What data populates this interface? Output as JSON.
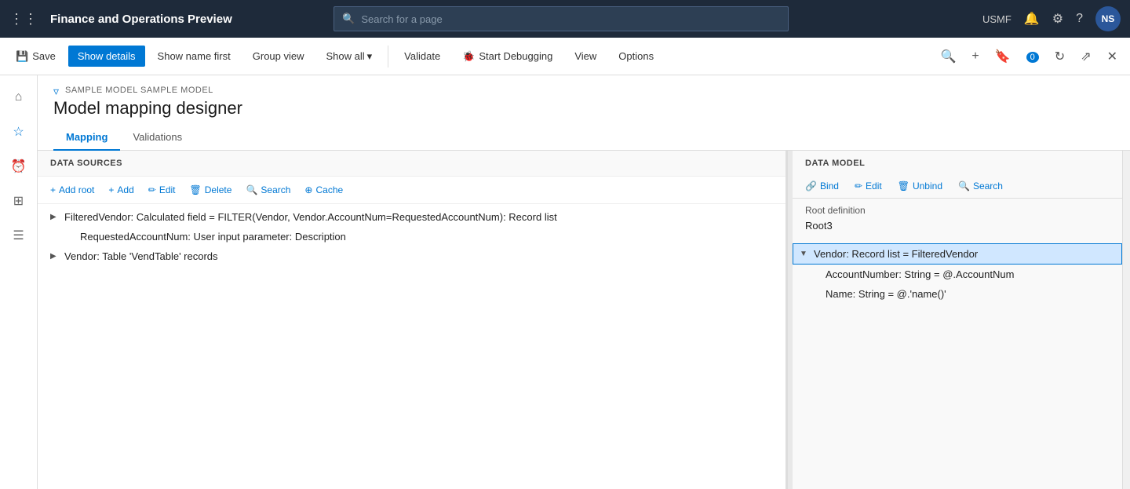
{
  "app": {
    "title": "Finance and Operations Preview",
    "env": "USMF"
  },
  "search_bar": {
    "placeholder": "Search for a page"
  },
  "toolbar": {
    "save_label": "Save",
    "show_details_label": "Show details",
    "show_name_first_label": "Show name first",
    "group_view_label": "Group view",
    "show_all_label": "Show all",
    "validate_label": "Validate",
    "start_debugging_label": "Start Debugging",
    "view_label": "View",
    "options_label": "Options"
  },
  "breadcrumb": "SAMPLE MODEL SAMPLE MODEL",
  "page_title": "Model mapping designer",
  "tabs": [
    {
      "label": "Mapping",
      "active": true
    },
    {
      "label": "Validations",
      "active": false
    }
  ],
  "data_sources": {
    "header": "DATA SOURCES",
    "toolbar_buttons": [
      {
        "label": "Add root",
        "icon": "+"
      },
      {
        "label": "Add",
        "icon": "+"
      },
      {
        "label": "Edit",
        "icon": "✏"
      },
      {
        "label": "Delete",
        "icon": "🗑"
      },
      {
        "label": "Search",
        "icon": "🔍"
      },
      {
        "label": "Cache",
        "icon": "⊕"
      }
    ],
    "tree": [
      {
        "id": "filtered-vendor",
        "label": "FilteredVendor: Calculated field = FILTER(Vendor, Vendor.AccountNum=RequestedAccountNum): Record list",
        "indent": 0,
        "expandable": true,
        "selected": false
      },
      {
        "id": "requested-account",
        "label": "RequestedAccountNum: User input parameter: Description",
        "indent": 1,
        "expandable": false,
        "selected": false
      },
      {
        "id": "vendor-table",
        "label": "Vendor: Table 'VendTable' records",
        "indent": 0,
        "expandable": true,
        "selected": false
      }
    ]
  },
  "data_model": {
    "header": "DATA MODEL",
    "toolbar_buttons": [
      {
        "label": "Bind",
        "icon": "🔗"
      },
      {
        "label": "Edit",
        "icon": "✏"
      },
      {
        "label": "Unbind",
        "icon": "🗑"
      },
      {
        "label": "Search",
        "icon": "🔍"
      }
    ],
    "root_definition_label": "Root definition",
    "root_value": "Root3",
    "tree": [
      {
        "id": "vendor-record",
        "label": "Vendor: Record list = FilteredVendor",
        "indent": 0,
        "expandable": true,
        "expanded": true,
        "selected": true
      },
      {
        "id": "account-number",
        "label": "AccountNumber: String = @.AccountNum",
        "indent": 1,
        "expandable": false,
        "selected": false
      },
      {
        "id": "name-string",
        "label": "Name: String = @.'name()'",
        "indent": 1,
        "expandable": false,
        "selected": false
      }
    ]
  },
  "icons": {
    "grid": "⊞",
    "home": "⌂",
    "star": "★",
    "clock": "🕐",
    "table": "⊞",
    "list": "☰",
    "filter": "▽",
    "search": "🔍",
    "bell": "🔔",
    "settings": "⚙",
    "help": "?",
    "pin": "📌",
    "bookmark": "🔖",
    "refresh": "↺",
    "expand": "⤢",
    "close": "✕",
    "chevron_down": "▾",
    "save": "💾"
  }
}
